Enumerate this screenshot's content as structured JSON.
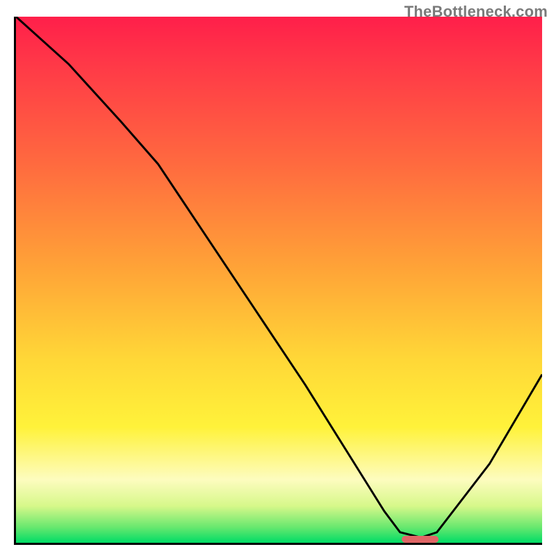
{
  "watermark": "TheBottleneck.com",
  "chart_data": {
    "type": "line",
    "title": "",
    "xlabel": "",
    "ylabel": "",
    "xlim": [
      0,
      100
    ],
    "ylim": [
      0,
      100
    ],
    "grid": false,
    "legend": false,
    "series": [
      {
        "name": "bottleneck-curve",
        "x": [
          0,
          10,
          20,
          27,
          35,
          45,
          55,
          65,
          70,
          73,
          77,
          80,
          90,
          100
        ],
        "y": [
          100,
          91,
          80,
          72,
          60,
          45,
          30,
          14,
          6,
          2,
          1,
          2,
          15,
          32
        ]
      }
    ],
    "marker": {
      "name": "optimal-range",
      "x_start": 73,
      "x_end": 80,
      "y": 1,
      "color": "#e06666"
    },
    "colors": {
      "gradient_top": "#ff1f4a",
      "gradient_mid": "#ffd737",
      "gradient_bottom": "#00dc66",
      "curve": "#000000",
      "marker": "#e06666"
    }
  }
}
